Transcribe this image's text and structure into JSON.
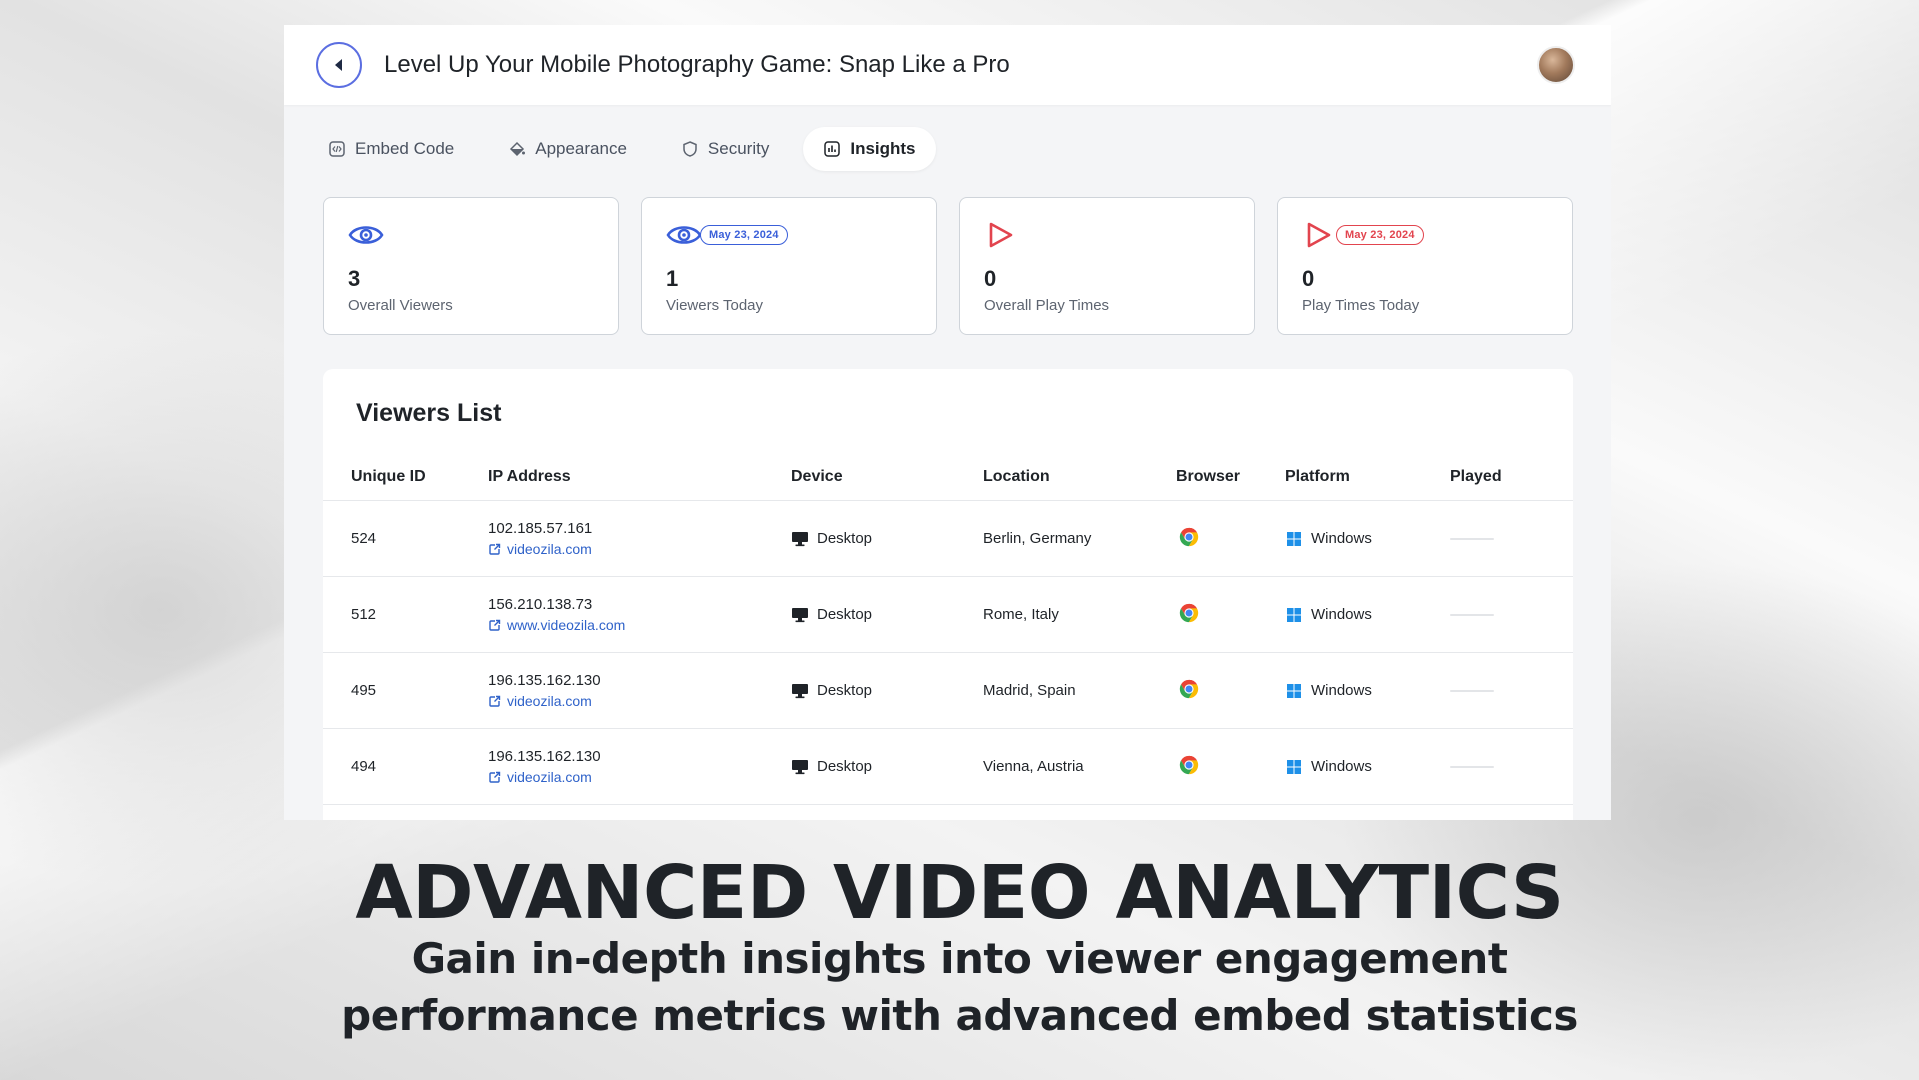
{
  "header": {
    "title": "Level Up Your Mobile Photography Game: Snap Like a Pro"
  },
  "tabs": [
    {
      "label": "Embed Code",
      "icon": "code-icon"
    },
    {
      "label": "Appearance",
      "icon": "paint-bucket-icon"
    },
    {
      "label": "Security",
      "icon": "shield-icon"
    },
    {
      "label": "Insights",
      "icon": "chart-icon",
      "active": true
    }
  ],
  "stats": [
    {
      "value": "3",
      "label": "Overall Viewers",
      "icon": "eye-icon",
      "color": "#3a5fd9"
    },
    {
      "value": "1",
      "label": "Viewers Today",
      "icon": "eye-icon",
      "badge": "May 23, 2024",
      "color": "#3a5fd9"
    },
    {
      "value": "0",
      "label": "Overall Play Times",
      "icon": "play-icon",
      "color": "#e2444e"
    },
    {
      "value": "0",
      "label": "Play Times Today",
      "icon": "play-icon",
      "badge": "May 23, 2024",
      "color": "#e2444e"
    }
  ],
  "viewers": {
    "title": "Viewers List",
    "columns": [
      "Unique ID",
      "IP Address",
      "Device",
      "Location",
      "Browser",
      "Platform",
      "Played"
    ],
    "rows": [
      {
        "id": "524",
        "ip": "102.185.57.161",
        "domain": "videozila.com",
        "device": "Desktop",
        "location": "Berlin, Germany",
        "browser": "chrome-icon",
        "platform": "Windows"
      },
      {
        "id": "512",
        "ip": "156.210.138.73",
        "domain": "www.videozila.com",
        "device": "Desktop",
        "location": "Rome, Italy",
        "browser": "chrome-icon",
        "platform": "Windows"
      },
      {
        "id": "495",
        "ip": "196.135.162.130",
        "domain": "videozila.com",
        "device": "Desktop",
        "location": "Madrid, Spain",
        "browser": "chrome-icon",
        "platform": "Windows"
      },
      {
        "id": "494",
        "ip": "196.135.162.130",
        "domain": "videozila.com",
        "device": "Desktop",
        "location": "Vienna, Austria",
        "browser": "chrome-icon",
        "platform": "Windows"
      }
    ]
  },
  "caption": {
    "headline": "ADVANCED VIDEO ANALYTICS",
    "line1": "Gain in-depth insights into viewer engagement",
    "line2": "performance metrics with advanced embed statistics"
  }
}
